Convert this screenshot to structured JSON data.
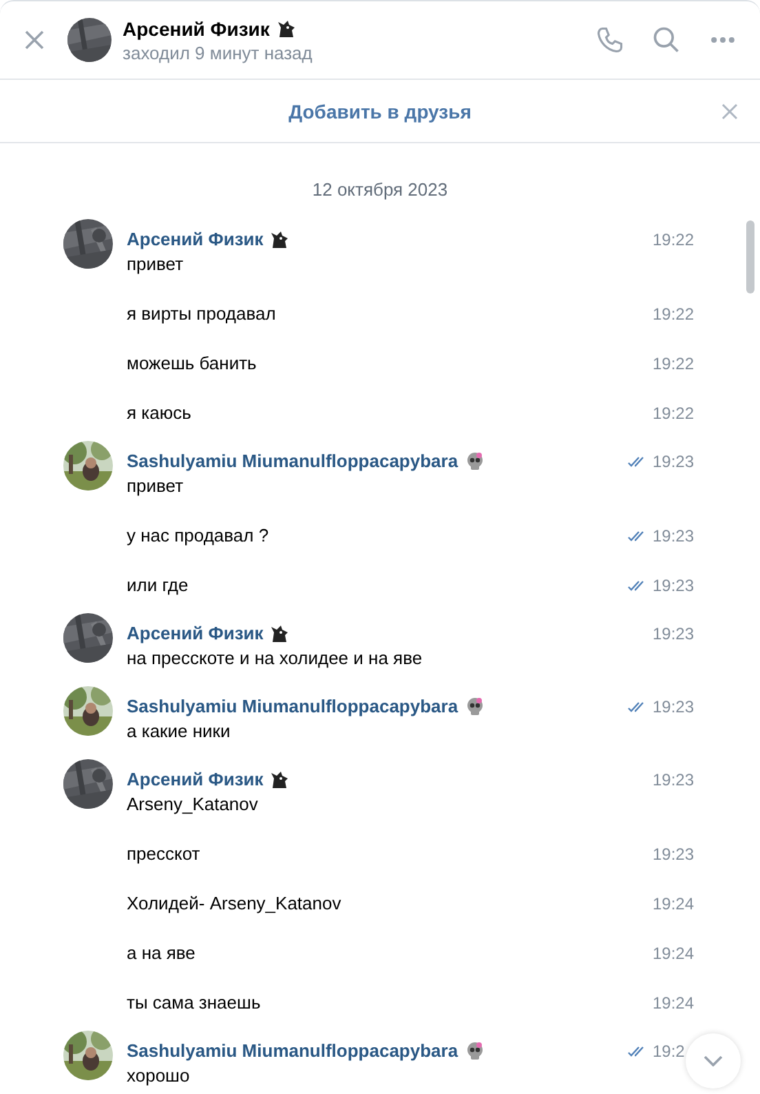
{
  "header": {
    "name": "Арсений Физик",
    "status": "заходил 9 минут назад"
  },
  "banner": {
    "action": "Добавить в друзья"
  },
  "date": "12 октября 2023",
  "messages": [
    {
      "kind": "incoming",
      "group_start": true,
      "author": "Арсений Физик",
      "text": "привет",
      "time": "19:22"
    },
    {
      "kind": "incoming",
      "group_start": false,
      "text": "я вирты продавал",
      "time": "19:22"
    },
    {
      "kind": "incoming",
      "group_start": false,
      "text": "можешь банить",
      "time": "19:22"
    },
    {
      "kind": "incoming",
      "group_start": false,
      "text": "я каюсь",
      "time": "19:22"
    },
    {
      "kind": "outgoing",
      "group_start": true,
      "author": "Sashulyamiu Miumanulfloppacapybara",
      "text": "привет",
      "time": "19:23"
    },
    {
      "kind": "outgoing",
      "group_start": false,
      "text": "у нас продавал ?",
      "time": "19:23"
    },
    {
      "kind": "outgoing",
      "group_start": false,
      "text": "или где",
      "time": "19:23"
    },
    {
      "kind": "incoming",
      "group_start": true,
      "author": "Арсений Физик",
      "text": "на пресскоте и на холидее и на яве",
      "time": "19:23"
    },
    {
      "kind": "outgoing",
      "group_start": true,
      "author": "Sashulyamiu Miumanulfloppacapybara",
      "text": "а какие ники",
      "time": "19:23"
    },
    {
      "kind": "incoming",
      "group_start": true,
      "author": "Арсений Физик",
      "text": "Arseny_Katanov",
      "time": "19:23"
    },
    {
      "kind": "incoming",
      "group_start": false,
      "text": "пресскот",
      "time": "19:23"
    },
    {
      "kind": "incoming",
      "group_start": false,
      "text": "Холидей- Arseny_Katanov",
      "time": "19:24"
    },
    {
      "kind": "incoming",
      "group_start": false,
      "text": "а на яве",
      "time": "19:24"
    },
    {
      "kind": "incoming",
      "group_start": false,
      "text": "ты сама знаешь",
      "time": "19:24"
    },
    {
      "kind": "outgoing",
      "group_start": true,
      "author": "Sashulyamiu Miumanulfloppacapybara",
      "text": "хорошо",
      "time": "19:2"
    }
  ]
}
